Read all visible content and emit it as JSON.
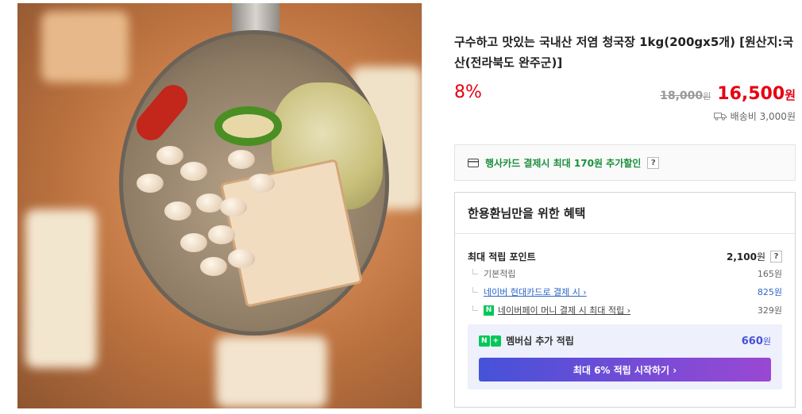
{
  "product": {
    "title": "구수하고 맛있는 국내산 저염 청국장 1kg(200gx5개) [원산지:국산(전라북도 완주군)]",
    "discount_rate": "8%",
    "original_price": "18,000",
    "original_price_unit": "원",
    "sale_price": "16,500",
    "sale_price_unit": "원",
    "shipping": "배송비 3,000원"
  },
  "card_promo": {
    "text": "행사카드 결제시 최대 170원 추가할인",
    "help": "?"
  },
  "benefit": {
    "heading": "한용환님만을 위한 혜택",
    "max_points_label": "최대 적립 포인트",
    "max_points_value": "2,100",
    "max_points_unit": "원",
    "help": "?",
    "rows": [
      {
        "label": "기본적립",
        "value": "165원"
      },
      {
        "label": "네이버 현대카드로 결제 시 ›",
        "value": "825원"
      },
      {
        "label": "네이버페이 머니 결제 시 최대 적립 ›",
        "value": "329원",
        "badge": "N"
      }
    ],
    "membership": {
      "badge_n": "N",
      "badge_plus": "+",
      "label": "멤버십 추가 적립",
      "amount": "660",
      "amount_unit": "원",
      "cta": "최대 6% 적립 시작하기 ›"
    }
  },
  "colors": {
    "price_red": "#e60012",
    "naver_green": "#03c75a",
    "link_blue": "#2e66c7",
    "membership_bg": "#eef0fb"
  }
}
